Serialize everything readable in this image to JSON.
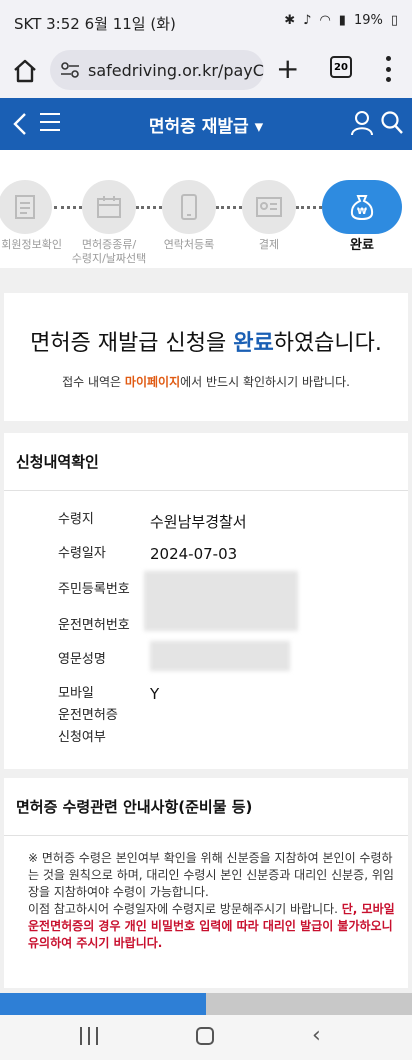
{
  "status": {
    "time": "SKT 3:52  6월 11일 (화)",
    "battery": "19%"
  },
  "browser": {
    "url": "safedriving.or.kr/payCo",
    "tab_count": "20"
  },
  "header": {
    "title": "면허증 재발급 ▾"
  },
  "steps": [
    {
      "label": "회원정보확인"
    },
    {
      "label": "면허증종류/\n수령지/날짜선택"
    },
    {
      "label": "연락처등록"
    },
    {
      "label": "결제"
    },
    {
      "label": "완료"
    }
  ],
  "done": {
    "msg_before": "면허증 재발급 신청을 ",
    "msg_highlight": "완료",
    "msg_after": "하였습니다.",
    "sub_before": "접수 내역은 ",
    "sub_highlight": "마이페이지",
    "sub_after": "에서 반드시 확인하시기 바랍니다."
  },
  "detail": {
    "title": "신청내역확인",
    "rows": [
      {
        "label": "수령지",
        "value": "수원남부경찰서"
      },
      {
        "label": "수령일자",
        "value": "2024-07-03"
      },
      {
        "label": "주민등록번호",
        "value": ""
      },
      {
        "label": "운전면허번호",
        "value": ""
      },
      {
        "label": "영문성명",
        "value": ""
      },
      {
        "label": "모바일\n운전면허증\n신청여부",
        "value": "Y"
      }
    ]
  },
  "notice": {
    "title": "면허증 수령관련 안내사항(준비물 등)",
    "line1": "※ 면허증 수령은 본인여부 확인을 위해 신분증을 지참하여 본인이 수령하는 것을 원칙으로 하며, 대리인 수령시 본인 신분증과 대리인 신분증, 위임장을 지참하여야 수령이 가능합니다.",
    "line2": "이점 참고하시어 수령일자에 수령지로 방문해주시기 바랍니다. ",
    "line2_red": "단, 모바일 운전면허증의 경우 개인 비밀번호 입력에 따라 대리인 발급이 불가하오니 유의하여 주시기 바랍니다."
  }
}
